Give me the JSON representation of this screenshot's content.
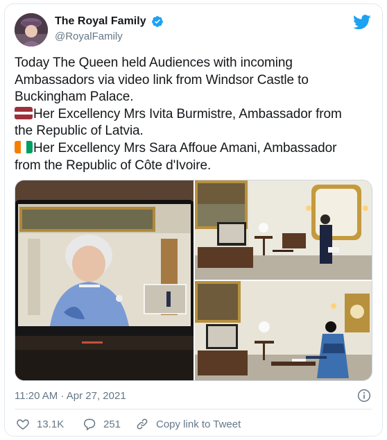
{
  "account": {
    "display_name": "The Royal Family",
    "handle": "@RoyalFamily",
    "verified": true,
    "brand_icon": "twitter-bird-icon"
  },
  "tweet": {
    "lines": [
      "Today The Queen held Audiences with incoming",
      "Ambassadors via video link from Windsor Castle to",
      "Buckingham Palace."
    ],
    "latvia_line_1": "Her Excellency Mrs Ivita Burmistre, Ambassador from",
    "latvia_line_2": "the Republic of Latvia.",
    "ivory_line_1": "Her Excellency Mrs Sara Affoue Amani, Ambassador",
    "ivory_line_2": "from the Republic of Côte d'Ivoire.",
    "flags": [
      "latvia-flag-icon",
      "cote-divoire-flag-icon"
    ]
  },
  "media": {
    "photos": [
      "queen-video-call-photo",
      "ambassador-latvia-photo",
      "ambassador-cote-divoire-photo"
    ]
  },
  "meta": {
    "timestamp": "11:20 AM · Apr 27, 2021"
  },
  "actions": {
    "likes": "13.1K",
    "replies": "251",
    "copy_link": "Copy link to Tweet"
  },
  "colors": {
    "twitter_blue": "#1da1f2",
    "secondary_text": "#657786",
    "border": "#e1e8ed"
  }
}
